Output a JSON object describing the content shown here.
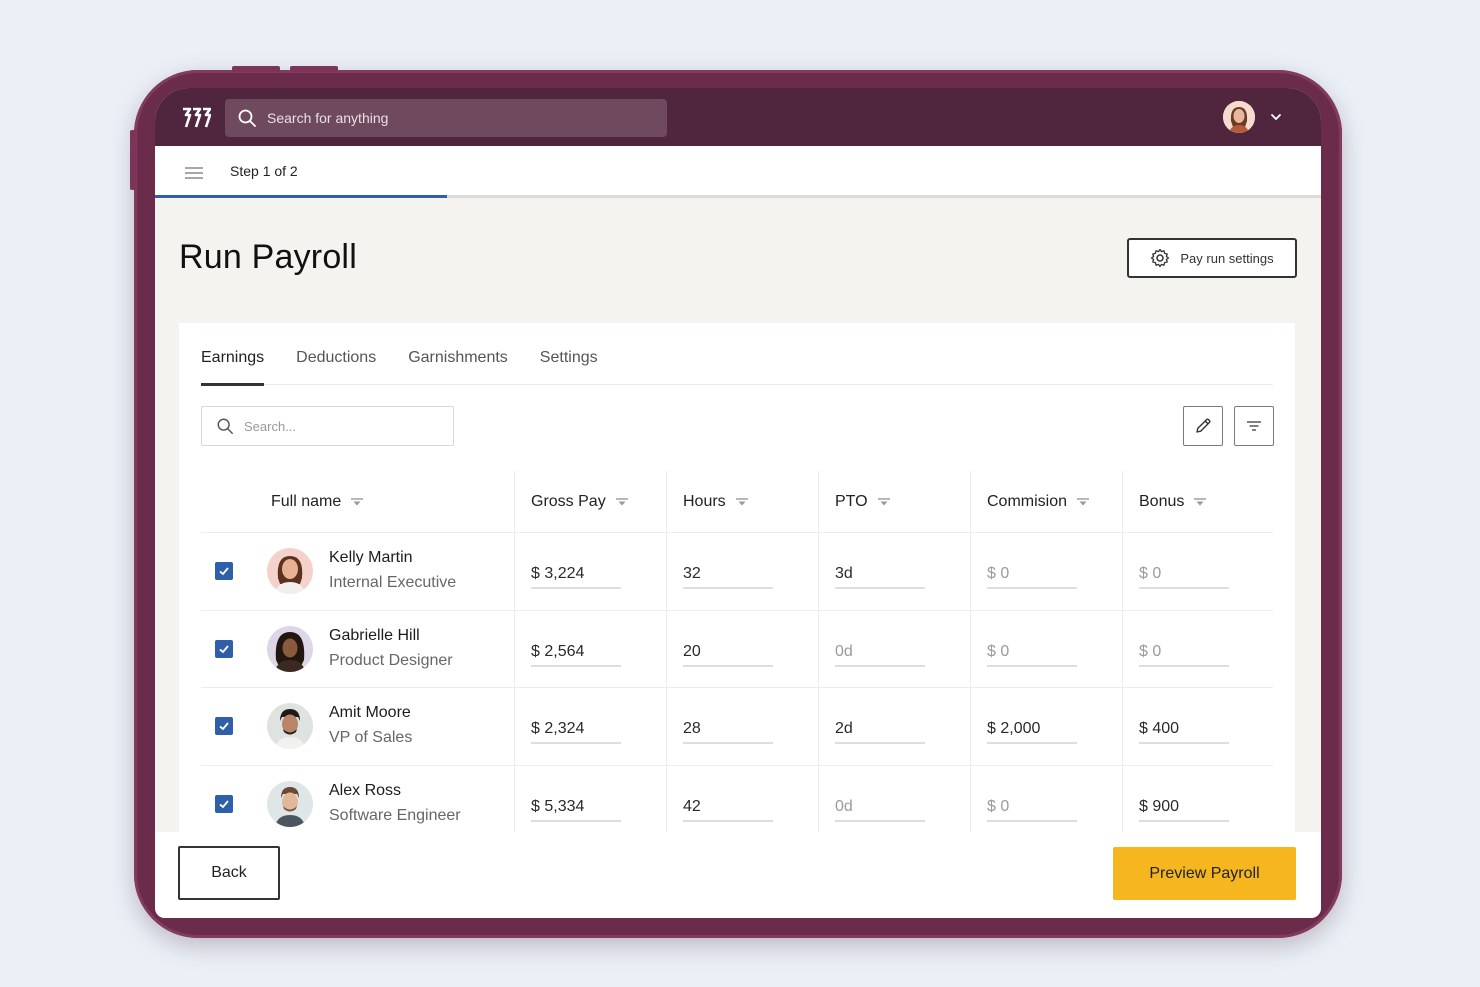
{
  "app": {
    "search_placeholder": "Search for anything",
    "step_text": "Step 1 of 2",
    "progress_fraction": 0.25
  },
  "page": {
    "title": "Run Payroll",
    "settings_button": "Pay run settings"
  },
  "tabs": [
    {
      "label": "Earnings",
      "active": true
    },
    {
      "label": "Deductions",
      "active": false
    },
    {
      "label": "Garnishments",
      "active": false
    },
    {
      "label": "Settings",
      "active": false
    }
  ],
  "table": {
    "search_placeholder": "Search...",
    "columns": [
      "Full name",
      "Gross Pay",
      "Hours",
      "PTO",
      "Commision",
      "Bonus"
    ],
    "rows": [
      {
        "name": "Kelly Martin",
        "role": "Internal Executive",
        "checked": true,
        "gross": "$ 3,224",
        "hours": "32",
        "pto": "3d",
        "commission": "$ 0",
        "bonus": "$ 0"
      },
      {
        "name": "Gabrielle Hill",
        "role": "Product Designer",
        "checked": true,
        "gross": "$ 2,564",
        "hours": "20",
        "pto": "0d",
        "commission": "$ 0",
        "bonus": "$ 0"
      },
      {
        "name": "Amit Moore",
        "role": "VP of Sales",
        "checked": true,
        "gross": "$ 2,324",
        "hours": "28",
        "pto": "2d",
        "commission": "$ 2,000",
        "bonus": "$ 400"
      },
      {
        "name": "Alex Ross",
        "role": "Software Engineer",
        "checked": true,
        "gross": "$ 5,334",
        "hours": "42",
        "pto": "0d",
        "commission": "$ 0",
        "bonus": "$ 900"
      }
    ]
  },
  "footer": {
    "back_label": "Back",
    "preview_label": "Preview Payroll"
  },
  "colors": {
    "topbar": "#4f263d",
    "frame": "#6b2c4c",
    "accent_blue": "#2f5fa8",
    "primary_button": "#f5b61f"
  }
}
